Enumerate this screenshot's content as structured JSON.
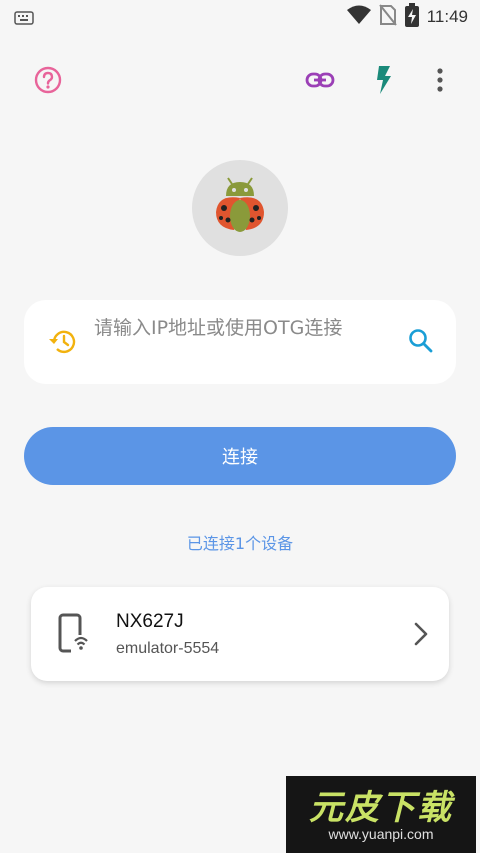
{
  "status_bar": {
    "time": "11:49",
    "icons": [
      "keyboard-icon",
      "wifi-icon",
      "no-sim-icon",
      "battery-charging-icon"
    ]
  },
  "toolbar": {
    "icons": [
      "help-icon",
      "link-icon",
      "flash-icon",
      "more-vert-icon"
    ],
    "colors": {
      "help": "#e8649a",
      "link": "#9b3fb6",
      "flash": "#1a8a7a",
      "more": "#555555"
    }
  },
  "logo": {
    "icon": "ladybug-android-icon"
  },
  "search": {
    "placeholder": "请输入IP地址或使用OTG连接",
    "value": "",
    "history_icon": "history-icon",
    "search_icon": "search-icon"
  },
  "connect_button": {
    "label": "连接",
    "color": "#5b95e6"
  },
  "connected_status": "已连接1个设备",
  "devices": [
    {
      "name": "NX627J",
      "id": "emulator-5554",
      "icon": "phone-wifi-icon"
    }
  ],
  "watermark": {
    "title": "元皮下载",
    "url": "www.yuanpi.com"
  }
}
